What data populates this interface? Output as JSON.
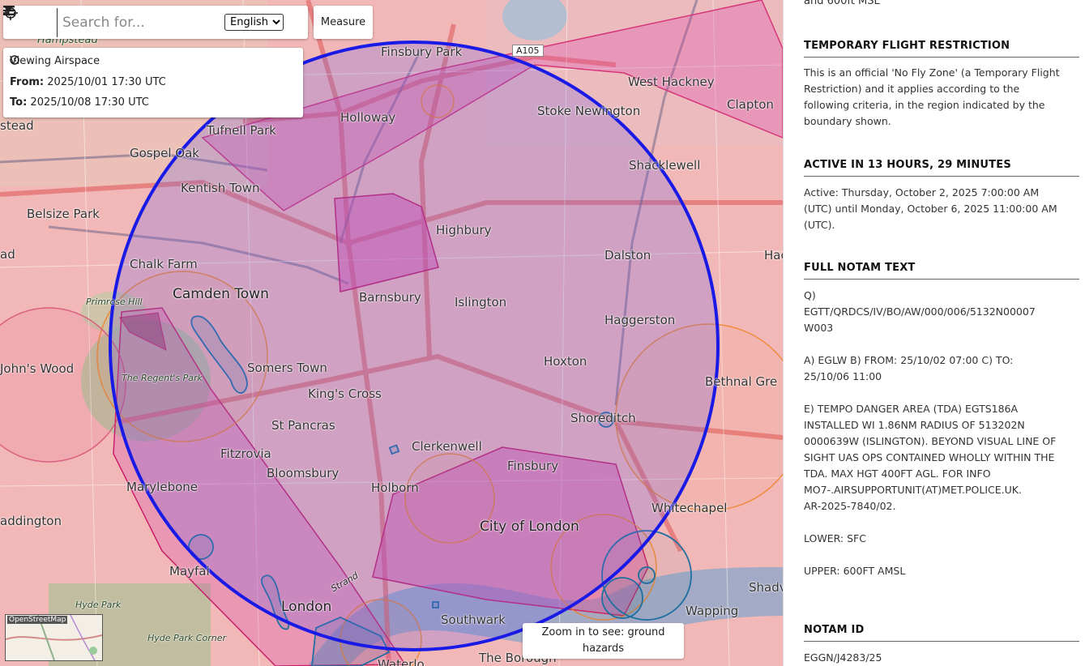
{
  "toolbar": {
    "menu_icon": "hamburger-menu-icon",
    "locate_icon": "crosshair-locate-icon",
    "filter_icon": "filter-funnel-icon",
    "search_placeholder": "Search for...",
    "language": "English",
    "measure_label": "Measure"
  },
  "viewing": {
    "icon": "clock-icon",
    "title": "Viewing Airspace",
    "from_label": "From:",
    "from_value": "2025/10/01 17:30 UTC",
    "to_label": "To:",
    "to_value": "2025/10/08 17:30 UTC"
  },
  "map": {
    "attribution_label": "OpenStreetMap",
    "zoom_hint": "Zoom in to see: ground hazards",
    "road_label": "A105",
    "colors": {
      "restriction_circle": "#1a1ae6",
      "no_fly_zone": "#d946a8",
      "danger_area": "#f08020",
      "hazard": "#1f6fa0",
      "base_tint": "#f2b8b8"
    },
    "place_labels": [
      "Hampstead",
      "Finsbury Park",
      "West Hackney",
      "Clapton",
      "Holloway",
      "Stoke Newington",
      "stead",
      "Tufnell Park",
      "Gospel Oak",
      "Shacklewell",
      "Kentish Town",
      "Belsize Park",
      "Highbury",
      "Dalston",
      "Chalk Farm",
      "Camden Town",
      "Barnsbury",
      "Islington",
      "Haggerston",
      "Primrose Hill",
      "John's Wood",
      "The Regent's Park",
      "Somers Town",
      "Hoxton",
      "King's Cross",
      "Bethnal Gre",
      "St Pancras",
      "Shoreditch",
      "Clerkenwell",
      "Fitzrovia",
      "Bloomsbury",
      "Finsbury",
      "Marylebone",
      "Holborn",
      "Whitechapel",
      "addington",
      "City of London",
      "Mayfai",
      "Hyde Park",
      "London",
      "Southwark",
      "Wapping",
      "Hyde Park Corner",
      "The Borough",
      "Waterlo",
      "Shadv",
      "Hac",
      "ad",
      "Strand"
    ]
  },
  "panel": {
    "top_text": "and 600ft MSL",
    "sections": [
      {
        "heading": "TEMPORARY FLIGHT RESTRICTION",
        "body": "This is an official 'No Fly Zone' (a Temporary Flight Restriction) and it applies according to the following criteria, in the region indicated by the boundary shown."
      },
      {
        "heading": "ACTIVE IN 13 HOURS, 29 MINUTES",
        "body": "Active: Thursday, October 2, 2025 7:00:00 AM (UTC) until Monday, October 6, 2025 11:00:00 AM (UTC)."
      },
      {
        "heading": "FULL NOTAM TEXT",
        "body": "Q)\nEGTT/QRDCS/IV/BO/AW/000/006/5132N00007\nW003\n\nA) EGLW B) FROM: 25/10/02 07:00 C) TO:\n25/10/06 11:00\n\nE) TEMPO DANGER AREA (TDA) EGTS186A INSTALLED WI 1.86NM RADIUS OF 513202N 0000639W (ISLINGTON). BEYOND VISUAL LINE OF SIGHT UAS OPS CONTAINED WHOLLY WITHIN THE TDA. MAX HGT 400FT AGL. FOR INFO\nMO7-.AIRSUPPORTUNIT(AT)MET.POLICE.UK.\nAR-2025-7840/02.\n\nLOWER: SFC\n\nUPPER: 600FT AMSL"
      },
      {
        "heading": "NOTAM ID",
        "body": "EGGN/J4283/25"
      }
    ]
  }
}
